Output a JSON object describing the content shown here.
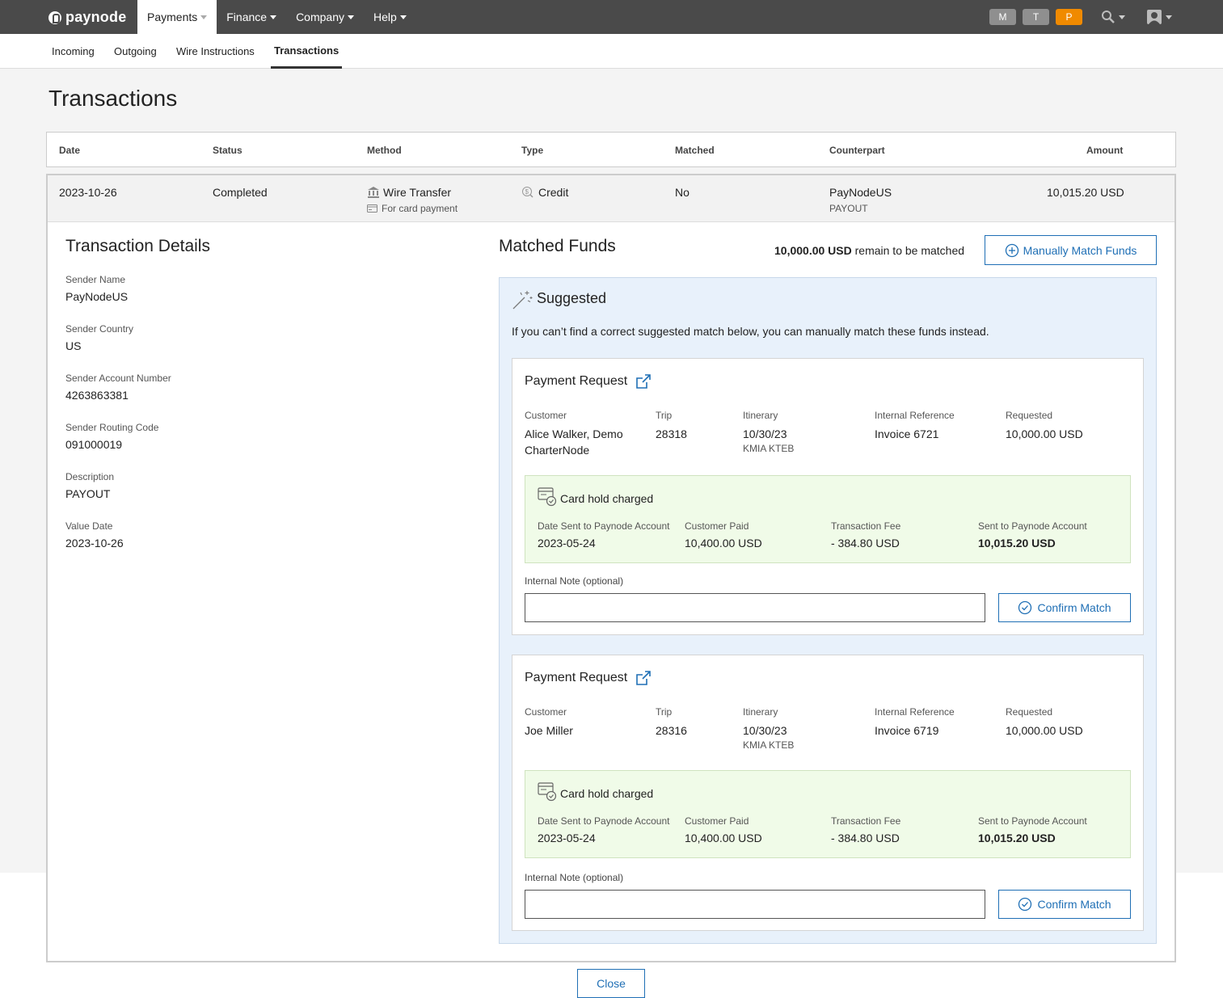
{
  "app": {
    "brand": "paynode",
    "nav": [
      {
        "label": "Payments",
        "active": true
      },
      {
        "label": "Finance"
      },
      {
        "label": "Company"
      },
      {
        "label": "Help"
      }
    ],
    "badges": [
      "M",
      "T",
      "P"
    ]
  },
  "subnav": {
    "tabs": [
      "Incoming",
      "Outgoing",
      "Wire Instructions",
      "Transactions"
    ],
    "active": "Transactions"
  },
  "page": {
    "title": "Transactions"
  },
  "table": {
    "headers": [
      "Date",
      "Status",
      "Method",
      "Type",
      "Matched",
      "Counterpart",
      "Amount"
    ],
    "row": {
      "date": "2023-10-26",
      "status": "Completed",
      "method": "Wire Transfer",
      "method_sub": "For card payment",
      "type": "Credit",
      "matched": "No",
      "counterpart": "PayNodeUS",
      "counterpart_sub": "PAYOUT",
      "amount": "10,015.20 USD"
    }
  },
  "details": {
    "title": "Transaction Details",
    "fields": [
      {
        "label": "Sender Name",
        "value": "PayNodeUS"
      },
      {
        "label": "Sender Country",
        "value": "US"
      },
      {
        "label": "Sender Account Number",
        "value": "4263863381"
      },
      {
        "label": "Sender Routing Code",
        "value": "091000019"
      },
      {
        "label": "Description",
        "value": "PAYOUT"
      },
      {
        "label": "Value Date",
        "value": "2023-10-26"
      }
    ]
  },
  "matched": {
    "title": "Matched Funds",
    "remain_amount": "10,000.00 USD",
    "remain_text": " remain to be matched",
    "manual_button": "Manually Match Funds",
    "suggested_title": "Suggested",
    "hint": "If you can’t find a correct suggested match below, you can manually match these funds instead.",
    "requests": [
      {
        "title": "Payment Request",
        "col_labels": [
          "Customer",
          "Trip",
          "Itinerary",
          "Internal Reference",
          "Requested"
        ],
        "customer": "Alice Walker, Demo CharterNode",
        "trip": "28318",
        "itinerary": "10/30/23",
        "itinerary_sub": "KMIA KTEB",
        "reference": "Invoice 6721",
        "requested": "10,000.00 USD",
        "hold_title": "Card hold charged",
        "hold_labels": [
          "Date Sent to Paynode Account",
          "Customer Paid",
          "Transaction Fee",
          "Sent to Paynode Account"
        ],
        "hold_values": [
          "2023-05-24",
          "10,400.00 USD",
          "- 384.80 USD",
          "10,015.20 USD"
        ],
        "note_label": "Internal Note (optional)",
        "confirm": "Confirm Match"
      },
      {
        "title": "Payment Request",
        "col_labels": [
          "Customer",
          "Trip",
          "Itinerary",
          "Internal Reference",
          "Requested"
        ],
        "customer": "Joe Miller",
        "trip": "28316",
        "itinerary": "10/30/23",
        "itinerary_sub": "KMIA KTEB",
        "reference": "Invoice 6719",
        "requested": "10,000.00 USD",
        "hold_title": "Card hold charged",
        "hold_labels": [
          "Date Sent to Paynode Account",
          "Customer Paid",
          "Transaction Fee",
          "Sent to Paynode Account"
        ],
        "hold_values": [
          "2023-05-24",
          "10,400.00 USD",
          "- 384.80 USD",
          "10,015.20 USD"
        ],
        "note_label": "Internal Note (optional)",
        "confirm": "Confirm Match"
      }
    ]
  },
  "footer": {
    "close": "Close"
  },
  "colors": {
    "nav_bg": "#4a4a4a",
    "accent": "#1f6fb5",
    "badge_orange": "#f08a00",
    "suggest_bg": "#e8f1fb",
    "hold_bg": "#f0fbe8"
  },
  "icons": [
    "search-icon",
    "user-icon",
    "bank-icon",
    "card-icon",
    "credit-icon",
    "plus-circle-icon",
    "wand-icon",
    "external-link-icon",
    "card-check-icon",
    "check-circle-icon"
  ]
}
